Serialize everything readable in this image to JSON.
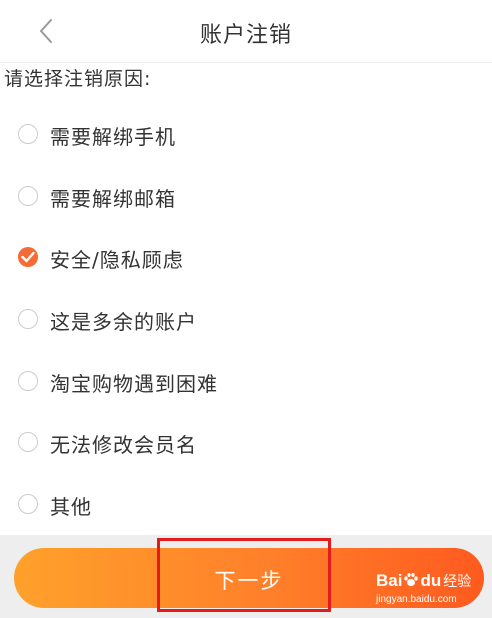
{
  "header": {
    "title": "账户注销",
    "back_icon": "chevron-left-icon"
  },
  "prompt": "请选择注销原因:",
  "options": [
    {
      "label": "需要解绑手机",
      "checked": false
    },
    {
      "label": "需要解绑邮箱",
      "checked": false
    },
    {
      "label": "安全/隐私顾虑",
      "checked": true
    },
    {
      "label": "这是多余的账户",
      "checked": false
    },
    {
      "label": "淘宝购物遇到困难",
      "checked": false
    },
    {
      "label": "无法修改会员名",
      "checked": false
    },
    {
      "label": "其他",
      "checked": false
    }
  ],
  "next_button": {
    "label": "下一步"
  },
  "watermark": {
    "brand_left": "Bai",
    "brand_right": "du",
    "cn": "经验",
    "url": "jingyan.baidu.com"
  },
  "colors": {
    "accent": "#f56a35",
    "button_gradient_start": "#ffa12b",
    "button_gradient_end": "#ff5a1f",
    "highlight": "#e41b1b"
  }
}
